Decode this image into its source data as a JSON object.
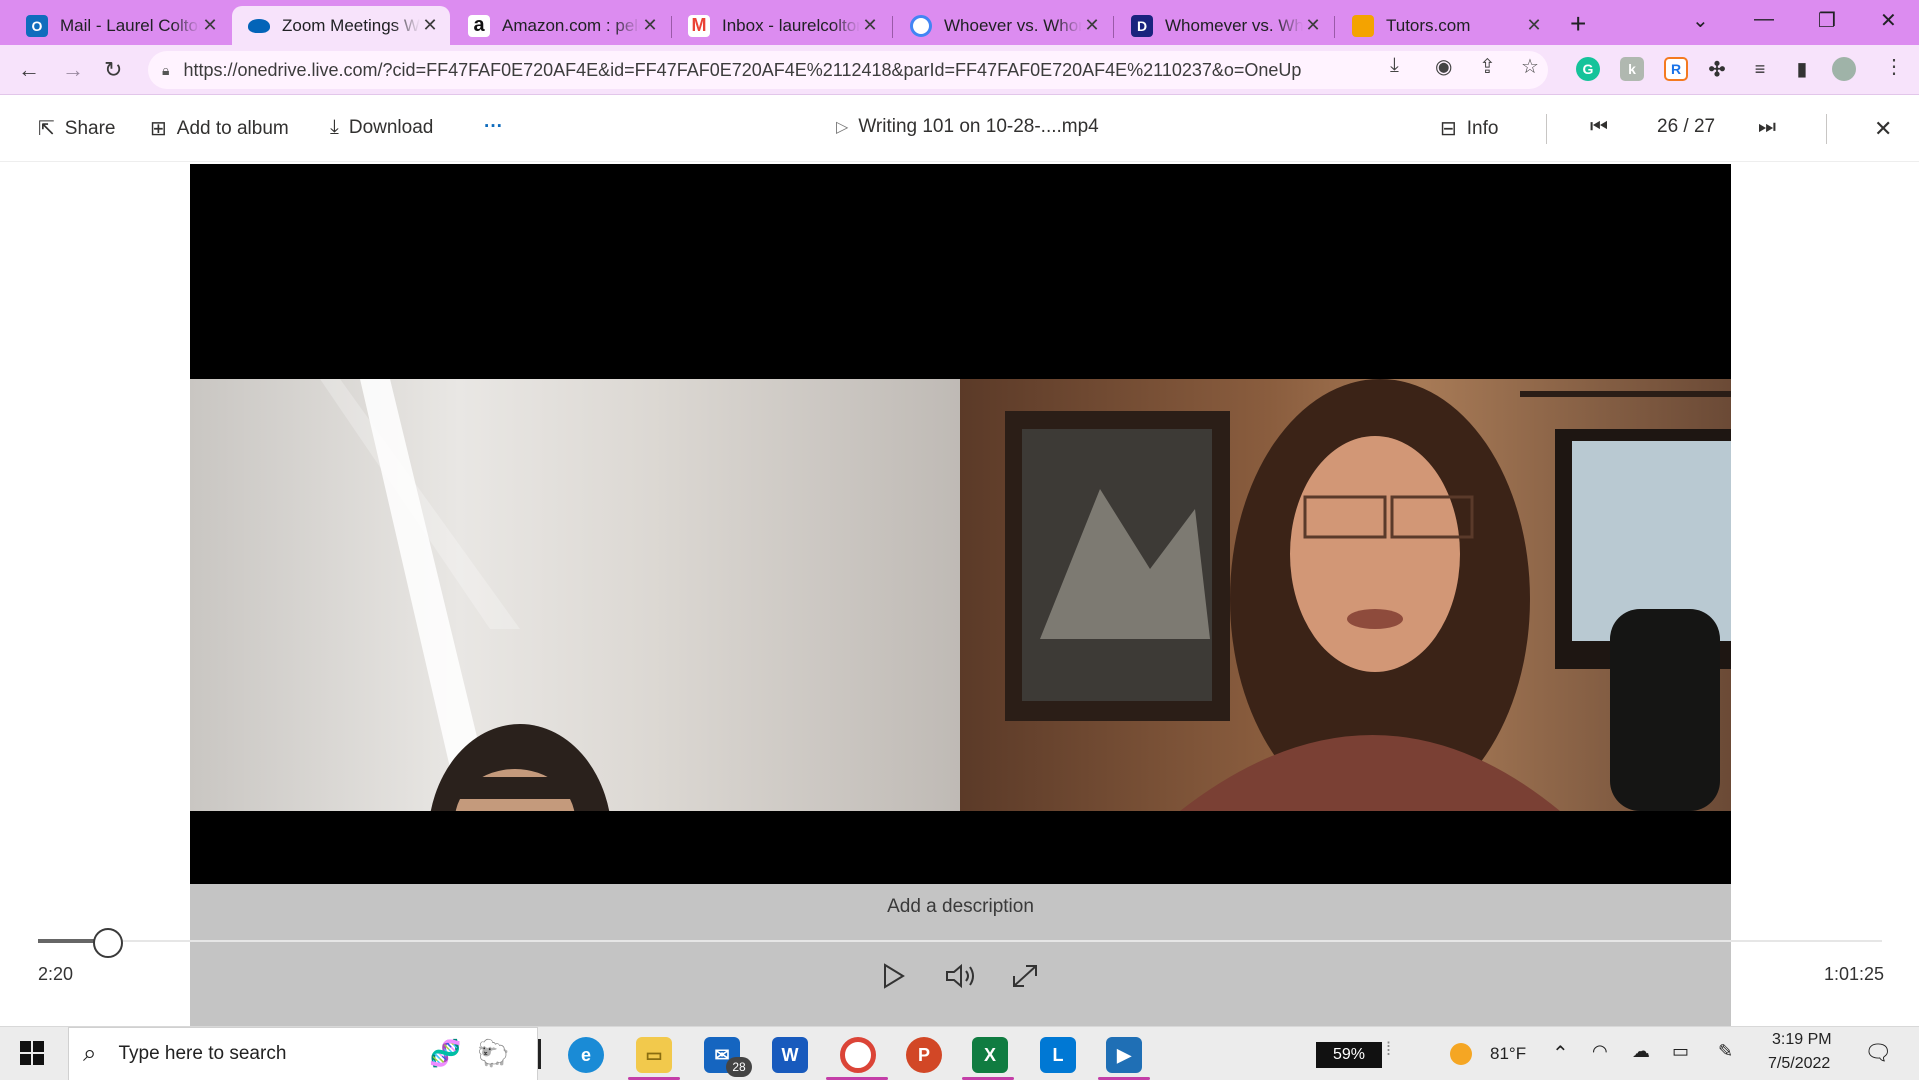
{
  "browser": {
    "tabs": [
      {
        "title": "Mail - Laurel Colton",
        "favicon": "outlook-icon",
        "color": "#0f6cbd"
      },
      {
        "title": "Zoom Meetings W",
        "favicon": "onedrive-icon",
        "color": "#0364b8",
        "active": true
      },
      {
        "title": "Amazon.com : pelo",
        "favicon": "amazon-icon",
        "color": "#111111"
      },
      {
        "title": "Inbox - laurelcolton",
        "favicon": "gmail-icon",
        "color": "#ea4335"
      },
      {
        "title": "Whoever vs. Whom",
        "favicon": "google-icon",
        "color": "#4285f4"
      },
      {
        "title": "Whomever vs. Who",
        "favicon": "dictionary-icon",
        "color": "#1a237e"
      },
      {
        "title": "Tutors.com",
        "favicon": "tutors-icon",
        "color": "#f4a300"
      }
    ],
    "url": "https://onedrive.live.com/?cid=FF47FAF0E720AF4E&id=FF47FAF0E720AF4E%2112418&parId=FF47FAF0E720AF4E%2110237&o=OneUp"
  },
  "command_bar": {
    "share": "Share",
    "add_to_album": "Add to album",
    "download": "Download",
    "more": "···",
    "file_name": "Writing 101 on 10-28-....mp4",
    "info": "Info",
    "position": "26 / 27"
  },
  "player": {
    "description_placeholder": "Add a description",
    "current_time": "2:20",
    "duration": "1:01:25",
    "progress_fraction": 0.038
  },
  "taskbar": {
    "search_placeholder": "Type here to search",
    "mail_badge": "28",
    "battery": "59%",
    "weather": "81°F",
    "time": "3:19 PM",
    "date": "7/5/2022"
  }
}
